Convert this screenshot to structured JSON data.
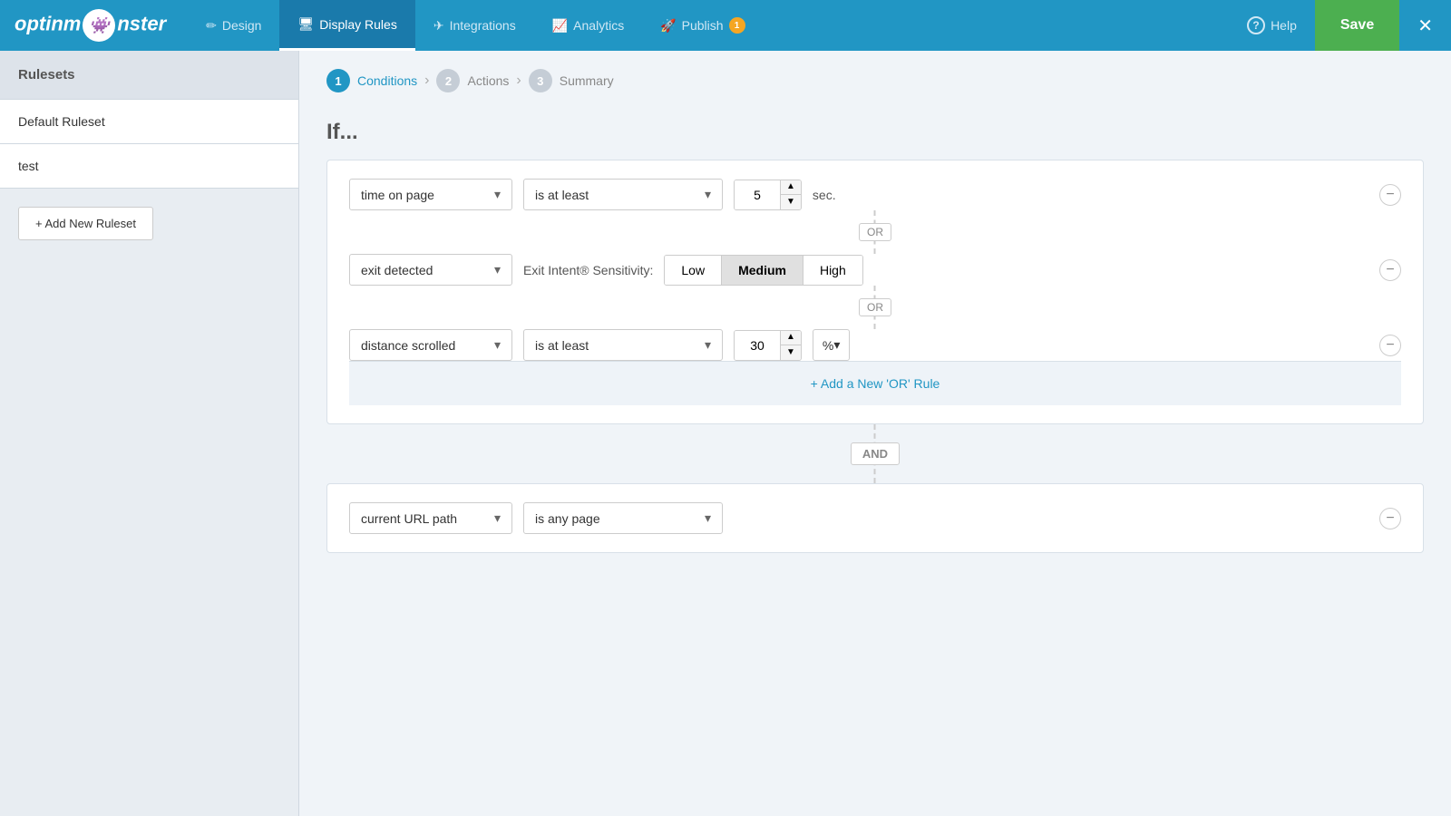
{
  "header": {
    "logo": "optinm⚙nster",
    "nav_items": [
      {
        "id": "design",
        "label": "Design",
        "icon": "✏️",
        "active": false
      },
      {
        "id": "display_rules",
        "label": "Display Rules",
        "icon": "🖥",
        "active": true
      },
      {
        "id": "integrations",
        "label": "Integrations",
        "icon": "✈",
        "active": false
      },
      {
        "id": "analytics",
        "label": "Analytics",
        "icon": "📈",
        "active": false
      },
      {
        "id": "publish",
        "label": "Publish",
        "icon": "🚀",
        "active": false,
        "badge": "1"
      }
    ],
    "help_label": "Help",
    "save_label": "Save",
    "close_icon": "✕"
  },
  "sidebar": {
    "title": "Rulesets",
    "items": [
      {
        "label": "Default Ruleset"
      },
      {
        "label": "test"
      }
    ],
    "add_button": "+ Add New Ruleset"
  },
  "steps": [
    {
      "num": "1",
      "label": "Conditions",
      "active": true
    },
    {
      "num": "2",
      "label": "Actions",
      "active": false
    },
    {
      "num": "3",
      "label": "Summary",
      "active": false
    }
  ],
  "if_label": "If...",
  "rules": {
    "block1": {
      "rows": [
        {
          "id": "row1",
          "condition_value": "time on page",
          "operator_value": "is at least",
          "number_value": "5",
          "unit_label": "sec."
        },
        {
          "id": "row2",
          "condition_value": "exit detected",
          "sensitivity_label": "Exit Intent® Sensitivity:",
          "sensitivity_options": [
            "Low",
            "Medium",
            "High"
          ],
          "sensitivity_active": "Medium"
        },
        {
          "id": "row3",
          "condition_value": "distance scrolled",
          "operator_value": "is at least",
          "number_value": "30",
          "unit_value": "%"
        }
      ],
      "add_or_label": "+ Add a New 'OR' Rule"
    },
    "and_label": "AND",
    "block2": {
      "rows": [
        {
          "id": "row4",
          "condition_value": "current URL path",
          "operator_value": "is any page"
        }
      ]
    }
  },
  "or_label": "OR"
}
